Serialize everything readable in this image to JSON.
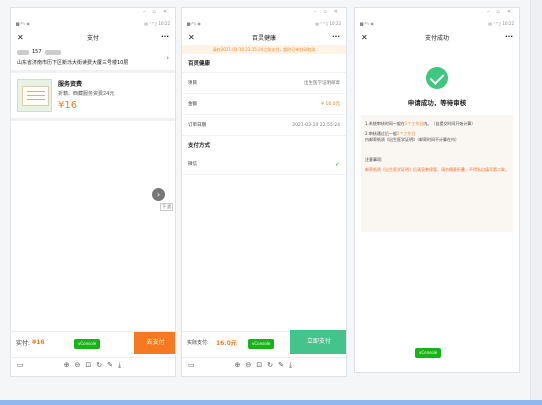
{
  "status_bar": {
    "left": "▆ᵢₗ⁴⁶ᵢₗ ◉",
    "right": "▤ ⁿ ⁸ ▯ 10:22"
  },
  "window_controls": {
    "min": "–",
    "max": "▫",
    "close": "✕"
  },
  "phone1": {
    "nav": {
      "close": "✕",
      "title": "支付",
      "more": "···"
    },
    "address": {
      "phone": "157",
      "line": "山东省济南市历下区新泺大街读费大厦三号楼10层",
      "chevron": "›"
    },
    "service": {
      "title": "服务资费",
      "desc": "折籍、西藏服务资费24元",
      "price": "¥16"
    },
    "float_button": "›",
    "float_tag": "下 武",
    "pay": {
      "label": "实付:",
      "amount": "¥16",
      "button": "去支付"
    },
    "vconsole": "vConsole"
  },
  "phone2": {
    "nav": {
      "close": "✕",
      "title": "百灵健康",
      "more": "···"
    },
    "notice": "请在2021-03-10 23:15:24之前支付，超时订单自动取消",
    "section_title": "百灵健康",
    "rows": [
      {
        "label": "项目",
        "value": "出生医学证明邮寄"
      },
      {
        "label": "金额",
        "value": "¥ 16.0元"
      },
      {
        "label": "订单日期",
        "value": "2021-03-10 22:55:24"
      }
    ],
    "payment_title": "支付方式",
    "payment_method": "微信",
    "check": "✓",
    "pay": {
      "label": "实际支付:",
      "amount": "16.0元",
      "button": "立即支付"
    },
    "vconsole": "vConsole"
  },
  "phone3": {
    "nav": {
      "close": "✕",
      "title": "支付成功",
      "more": "···"
    },
    "headline": "申请成功，等待审核",
    "info": {
      "p1_a": "1.系统审核时间一般在",
      "p1_o": "2个工作日",
      "p1_b": "内。（自提交时间开始计算）",
      "p2_a": "2.审核通过后一般",
      "p2_o": "2个工作日",
      "p2_b": "内邮寄纸质《出生医学证明》（邮寄时间不计算在内）",
      "note_title": "注意事项:",
      "warning": "邮寄纸质《出生医学证明》后请妥善保管，请勿随意折叠，不得私自填写第二联。"
    },
    "vconsole": "vConsole"
  },
  "toolbar": {
    "phone": "▭",
    "zoom_in": "⊕",
    "zoom_out": "⊖",
    "fit": "⊡",
    "rotate": "↻",
    "edit": "✎",
    "download": "⤓"
  }
}
